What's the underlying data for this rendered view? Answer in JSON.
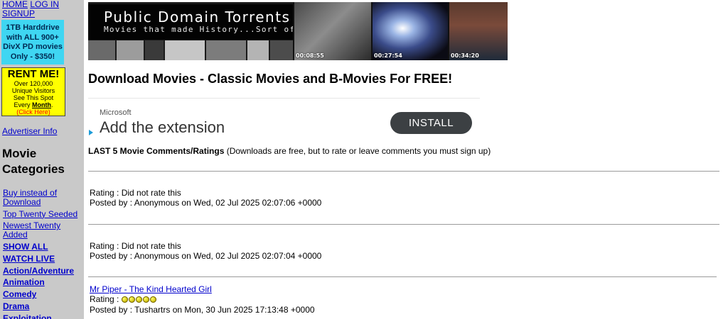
{
  "sidebar": {
    "top_links": [
      "HOME",
      "LOG IN",
      "SIGNUP"
    ],
    "promo_hdd": [
      "1TB Harddrive",
      "with ALL 900+",
      "DivX PD movies",
      "Only - $350!"
    ],
    "rent": {
      "title": "RENT ME!",
      "body": [
        "Over 120,000",
        "Unique Visitors",
        "See This Spot"
      ],
      "every": "Every",
      "month": "Month",
      "click": "(Click Here)"
    },
    "advertiser_info": "Advertiser Info",
    "categories_heading": [
      "Movie",
      "Categories"
    ],
    "categories": [
      {
        "label": "Buy instead of Download",
        "bold": false
      },
      {
        "label": "Top Twenty Seeded",
        "bold": false
      },
      {
        "label": "Newest Twenty Added",
        "bold": false
      },
      {
        "label": "SHOW ALL",
        "bold": true
      },
      {
        "label": "WATCH LIVE",
        "bold": true
      },
      {
        "label": "Action/Adventure",
        "bold": true
      },
      {
        "label": "Animation",
        "bold": true
      },
      {
        "label": "Comedy",
        "bold": true
      },
      {
        "label": "Drama",
        "bold": true
      },
      {
        "label": "Exploitation",
        "bold": true
      }
    ]
  },
  "banner": {
    "title": "Public Domain Torrents",
    "subtitle": "Movies that made History...Sort of...",
    "timestamps": [
      "00:08:55",
      "00:27:54",
      "00:34:20"
    ]
  },
  "main": {
    "heading": "Download Movies - Classic Movies and B-Movies For FREE!",
    "ad": {
      "sponsor": "Microsoft",
      "headline": "Add the extension",
      "button": "INSTALL"
    },
    "comments_intro_bold": "LAST 5 Movie Comments/Ratings",
    "comments_intro_rest": " (Downloads are free, but to rate or leave comments you must sign up)",
    "comments": [
      {
        "title": "",
        "rating": "Rating : Did not rate this",
        "rating_balls": 0,
        "posted": "Posted by : Anonymous on Wed, 02 Jul 2025 02:07:06 +0000"
      },
      {
        "title": "",
        "rating": "Rating : Did not rate this",
        "rating_balls": 0,
        "posted": "Posted by : Anonymous on Wed, 02 Jul 2025 02:07:04 +0000"
      },
      {
        "title": "Mr Piper - The Kind Hearted Girl",
        "rating": "Rating : ",
        "rating_balls": 5,
        "posted": "Posted by : Tushartrs on Mon, 30 Jun 2025 17:13:48 +0000"
      }
    ]
  },
  "colors": {
    "sidebar_bg": "#c9c9c9",
    "promo_cyan": "#3fd6f2",
    "rent_yellow": "#ffff00",
    "link_blue": "#0000cc",
    "install_button": "#3c4043"
  }
}
